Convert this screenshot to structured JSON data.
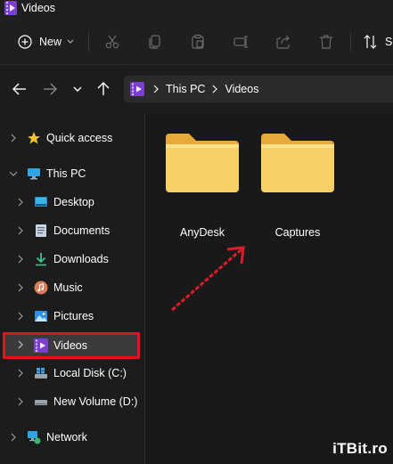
{
  "window": {
    "title": "Videos"
  },
  "toolbar": {
    "new_label": "New",
    "sort_label": "So"
  },
  "address": {
    "crumbs": [
      "This PC",
      "Videos"
    ]
  },
  "sidebar": {
    "items": [
      {
        "label": "Quick access",
        "icon": "star-icon"
      },
      {
        "label": "This PC",
        "icon": "monitor-icon"
      },
      {
        "label": "Desktop",
        "icon": "desktop-icon"
      },
      {
        "label": "Documents",
        "icon": "documents-icon"
      },
      {
        "label": "Downloads",
        "icon": "download-icon"
      },
      {
        "label": "Music",
        "icon": "music-icon"
      },
      {
        "label": "Pictures",
        "icon": "pictures-icon"
      },
      {
        "label": "Videos",
        "icon": "videos-icon",
        "selected": true
      },
      {
        "label": "Local Disk (C:)",
        "icon": "drive-icon"
      },
      {
        "label": "New Volume (D:)",
        "icon": "drive-icon"
      },
      {
        "label": "Network",
        "icon": "network-icon"
      }
    ]
  },
  "content": {
    "folders": [
      {
        "name": "AnyDesk"
      },
      {
        "name": "Captures"
      }
    ]
  },
  "watermark": {
    "text": "iTBit.ro"
  },
  "colors": {
    "highlight": "#e0161f",
    "arrow": "#d81e28",
    "folder": "#f7d066",
    "accent": "#8a4fe0"
  }
}
